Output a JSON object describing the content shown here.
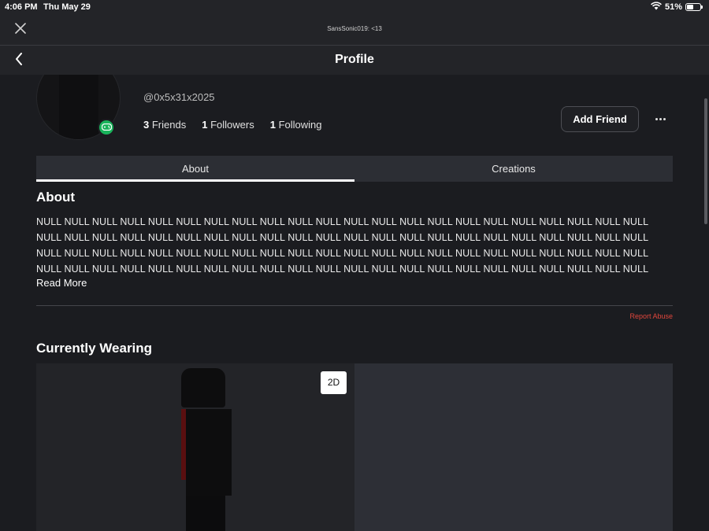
{
  "status_bar": {
    "time": "4:06 PM",
    "date": "Thu May 29",
    "battery": "51%",
    "battery_level": 0.51
  },
  "browser": {
    "title": "SansSonic019: <13"
  },
  "header": {
    "title": "Profile"
  },
  "profile": {
    "display_name": "0x5x31x2025",
    "username": "@0x5x31x2025",
    "stats": [
      {
        "count": "3",
        "label": "Friends"
      },
      {
        "count": "1",
        "label": "Followers"
      },
      {
        "count": "1",
        "label": "Following"
      }
    ],
    "add_friend_label": "Add Friend"
  },
  "tabs": [
    {
      "label": "About",
      "active": true
    },
    {
      "label": "Creations",
      "active": false
    }
  ],
  "about": {
    "title": "About",
    "text": "NULL NULL NULL NULL NULL NULL NULL NULL NULL NULL NULL NULL NULL NULL NULL NULL NULL NULL NULL NULL NULL NULL NULL NULL NULL NULL NULL NULL NULL NULL NULL NULL NULL NULL NULL NULL NULL NULL NULL NULL NULL NULL NULL NULL NULL NULL NULL NULL NULL NULL NULL NULL NULL NULL NULL NULL NULL NULL NULL NULL NULL NULL NULL NULL NULL NULL NULL NULL NULL NULL NULL NULL NULL NULL NULL NULL NULL NULL NULL NULL NULL NULL NULL NULL NULL NULL NULL NULL",
    "read_more": "Read More",
    "report": "Report Abuse"
  },
  "wearing": {
    "title": "Currently Wearing",
    "toggle_label": "2D"
  },
  "colors": {
    "background": "#1b1c20",
    "online": "#19b35b",
    "report": "#e0463c"
  }
}
